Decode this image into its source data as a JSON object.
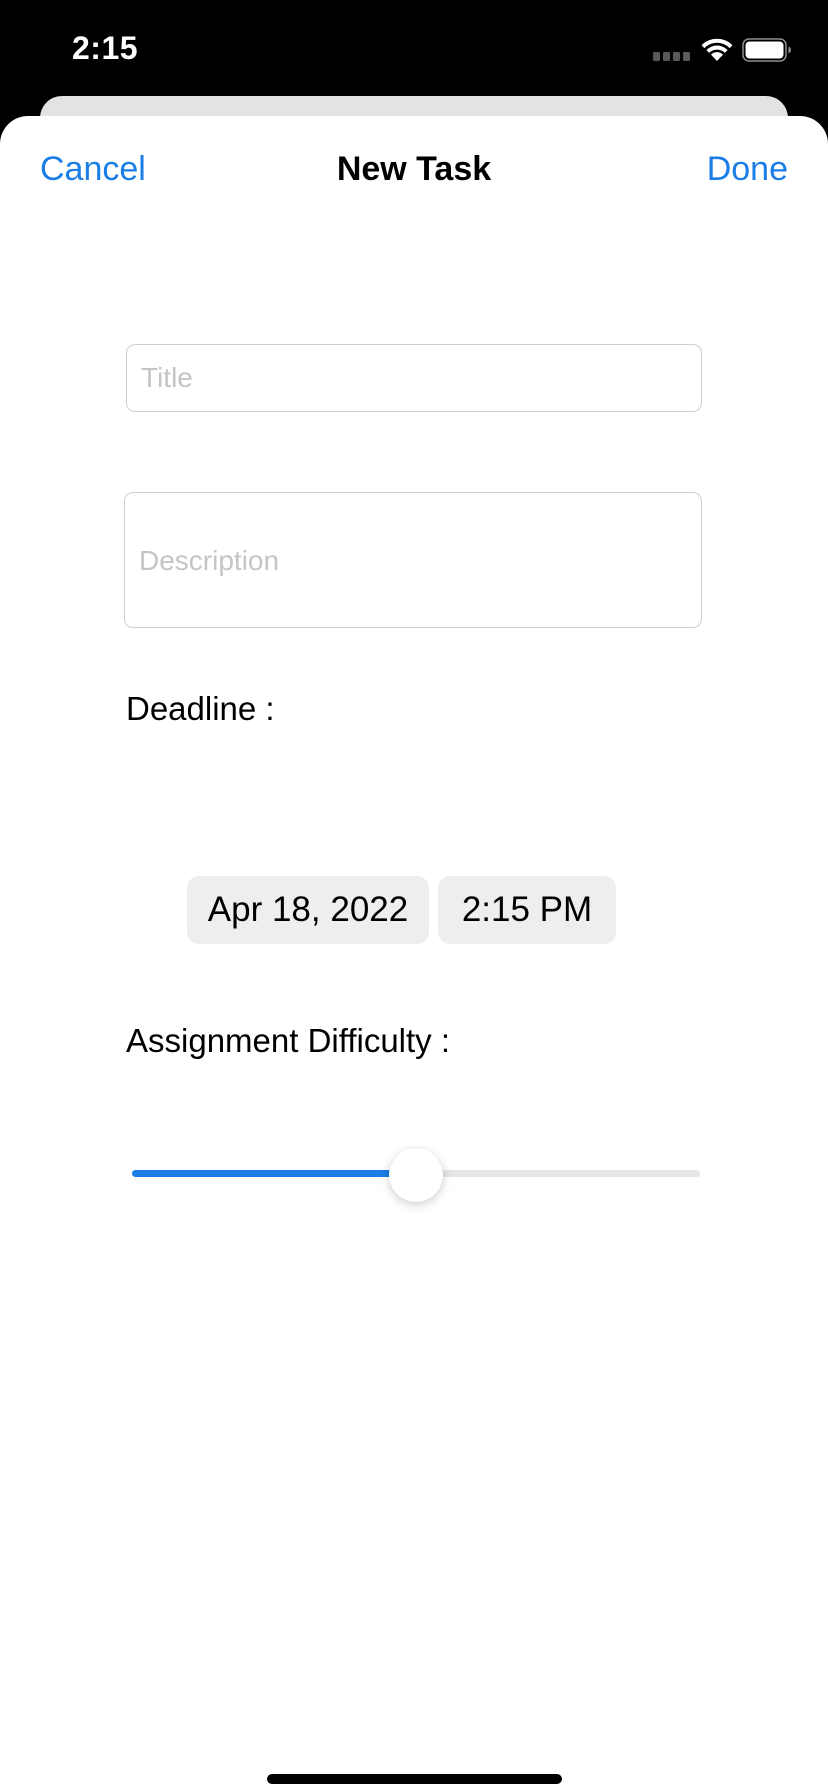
{
  "status_bar": {
    "time": "2:15",
    "icons": [
      "signal-icon",
      "wifi-icon",
      "battery-icon"
    ]
  },
  "nav": {
    "cancel_label": "Cancel",
    "title": "New Task",
    "done_label": "Done"
  },
  "form": {
    "title_placeholder": "Title",
    "title_value": "",
    "description_placeholder": "Description",
    "description_value": "",
    "deadline_label": "Deadline :",
    "deadline_date": "Apr 18, 2022",
    "deadline_time": "2:15 PM",
    "difficulty_label": "Assignment Difficulty :",
    "difficulty_value": 0.5
  },
  "colors": {
    "accent": "#1a7ee6",
    "sheet_background": "#ffffff",
    "picker_background": "#eeeeef"
  }
}
